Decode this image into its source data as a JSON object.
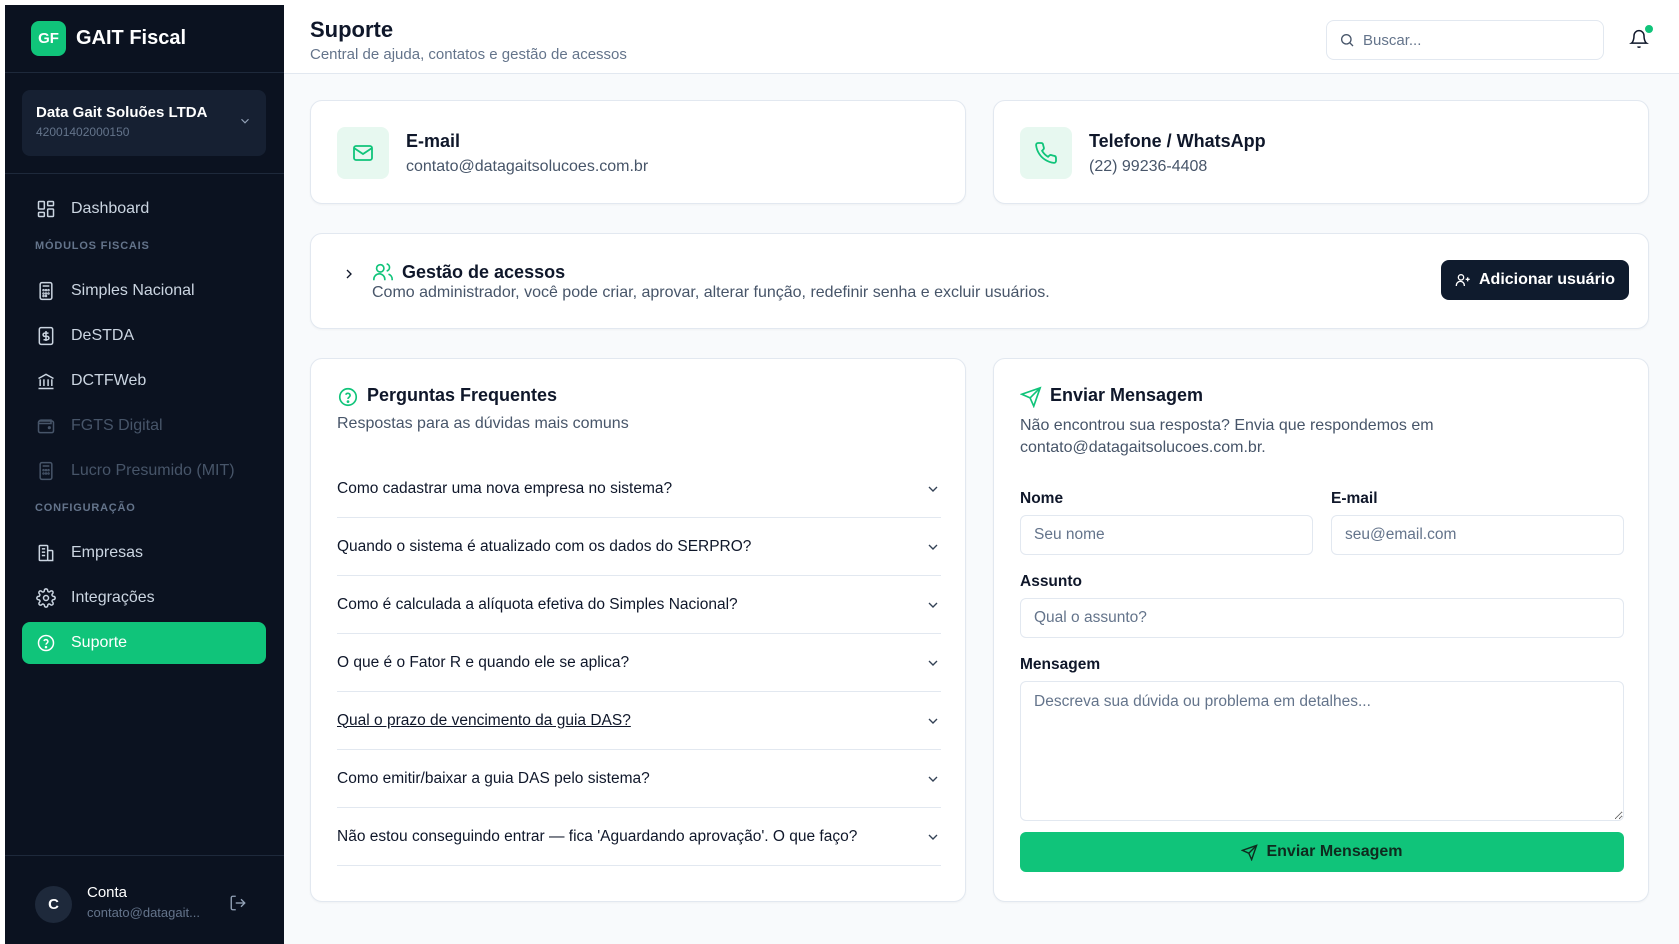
{
  "sidebar": {
    "logo_text": "GF",
    "brand": "GAIT Fiscal",
    "company": {
      "name": "Data Gait Soluões LTDA",
      "cnpj": "42001402000150"
    },
    "dashboard": "Dashboard",
    "section_fiscal": "MÓDULOS FISCAIS",
    "fiscal_items": [
      {
        "label": "Simples Nacional",
        "icon": "calculator-icon",
        "enabled": true
      },
      {
        "label": "DeSTDA",
        "icon": "dollar-doc-icon",
        "enabled": true
      },
      {
        "label": "DCTFWeb",
        "icon": "bank-icon",
        "enabled": true
      },
      {
        "label": "FGTS Digital",
        "icon": "wallet-icon",
        "enabled": false
      },
      {
        "label": "Lucro Presumido (MIT)",
        "icon": "calculator-icon",
        "enabled": false
      }
    ],
    "section_config": "CONFIGURAÇÃO",
    "config_items": [
      {
        "label": "Empresas",
        "icon": "building-icon"
      },
      {
        "label": "Integrações",
        "icon": "gear-icon"
      },
      {
        "label": "Suporte",
        "icon": "help-circle-icon",
        "active": true
      }
    ],
    "account": {
      "initial": "C",
      "name": "Conta",
      "email": "contato@datagait..."
    }
  },
  "header": {
    "title": "Suporte",
    "subtitle": "Central de ajuda, contatos e gestão de acessos",
    "search_placeholder": "Buscar..."
  },
  "contacts": {
    "email": {
      "label": "E-mail",
      "value": "contato@datagaitsolucoes.com.br"
    },
    "phone": {
      "label": "Telefone / WhatsApp",
      "value": "(22) 99236-4408"
    }
  },
  "access": {
    "title": "Gestão de acessos",
    "description": "Como administrador, você pode criar, aprovar, alterar função, redefinir senha e excluir usuários.",
    "button": "Adicionar usuário"
  },
  "faq": {
    "title": "Perguntas Frequentes",
    "subtitle": "Respostas para as dúvidas mais comuns",
    "items": [
      "Como cadastrar uma nova empresa no sistema?",
      "Quando o sistema é atualizado com os dados do SERPRO?",
      "Como é calculada a alíquota efetiva do Simples Nacional?",
      "O que é o Fator R e quando ele se aplica?",
      "Qual o prazo de vencimento da guia DAS?",
      "Como emitir/baixar a guia DAS pelo sistema?",
      "Não estou conseguindo entrar — fica 'Aguardando aprovação'. O que faço?"
    ]
  },
  "message": {
    "title": "Enviar Mensagem",
    "description": "Não encontrou sua resposta? Envia que respondemos em contato@datagaitsolucoes.com.br.",
    "name_label": "Nome",
    "name_placeholder": "Seu nome",
    "email_label": "E-mail",
    "email_placeholder": "seu@email.com",
    "subject_label": "Assunto",
    "subject_placeholder": "Qual o assunto?",
    "message_label": "Mensagem",
    "message_placeholder": "Descreva sua dúvida ou problema em detalhes...",
    "submit": "Enviar Mensagem"
  },
  "colors": {
    "accent": "#10c47a",
    "sidebar_bg": "#0b1220",
    "dark_button": "#0f1b2d"
  }
}
